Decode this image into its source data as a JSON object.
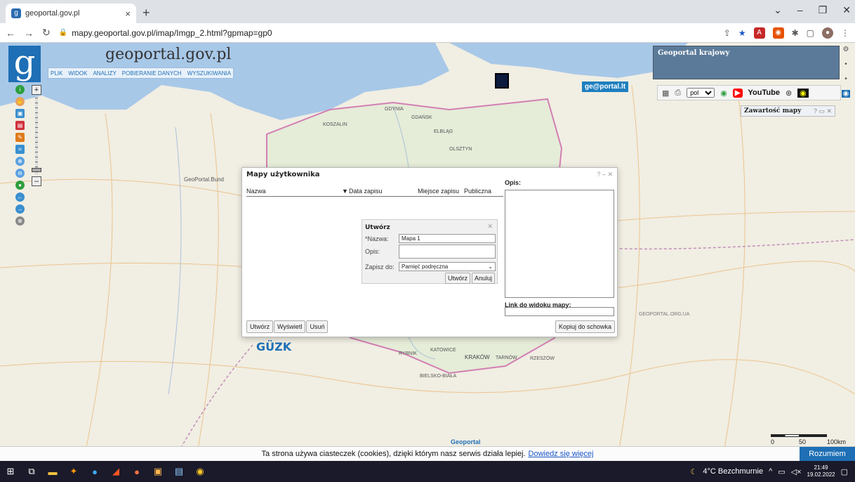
{
  "browser": {
    "tab_title": "geoportal.gov.pl",
    "url": "mapy.geoportal.gov.pl/imap/Imgp_2.html?gpmap=gp0"
  },
  "app": {
    "brand": "geoportal.gov.pl",
    "menu": [
      "PLIK",
      "WIDOK",
      "ANALIZY",
      "POBIERANIE DANYCH",
      "WYSZUKIWANIA"
    ]
  },
  "map": {
    "right_panel_title": "Geoportal krajowy",
    "geoportal_lt": "ge@portal.lt",
    "language": "pol",
    "youtube": "YouTube",
    "contents_title": "Zawartość mapy",
    "geoportal_left": "GeoPortal.Bund",
    "guk_logo": "GÜZK",
    "geoportal_ua": "GEOPORTAL.ORG.UA",
    "geoportal_bottom": "Geoportal",
    "scale": [
      "0",
      "50",
      "100km"
    ],
    "cities": [
      "GDYNIA",
      "GDAŃSK",
      "KOSZALIN",
      "ELBLĄG",
      "OLSZTYN",
      "KATOWICE",
      "KRAKÓW",
      "TARNÓW",
      "RZESZÓW",
      "RYBNIK",
      "BIELSKO-BIAŁA"
    ]
  },
  "dialog": {
    "title": "Mapy użytkownika",
    "columns": [
      "Nazwa",
      "Data zapisu",
      "Miejsce zapisu",
      "Publiczna"
    ],
    "desc_label": "Opis:",
    "link_label": "Link do widoku mapy:",
    "buttons": [
      "Utwórz",
      "Wyświetl",
      "Usuń"
    ],
    "copy_button": "Kopiuj do schowka",
    "sub": {
      "title": "Utwórz",
      "name_label": "*Nazwa:",
      "name_value": "Mapa 1",
      "desc_label": "Opis:",
      "save_label": "Zapisz do:",
      "save_value": "Pamięć podręczna",
      "create": "Utwórz",
      "cancel": "Anuluj"
    }
  },
  "cookie": {
    "text": "Ta strona używa ciasteczek (cookies), dzięki którym nasz serwis działa lepiej.",
    "link": "Dowiedz się więcej",
    "button": "Rozumiem"
  },
  "taskbar": {
    "weather": "4°C Bezchmurnie",
    "time": "21:49",
    "date": "19.02.2022"
  }
}
